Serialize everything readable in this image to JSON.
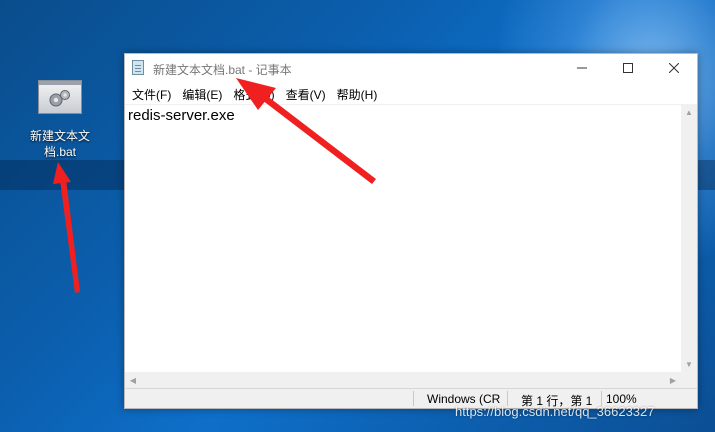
{
  "desktop": {
    "icon_label_line1": "新建文本文",
    "icon_label_line2": "档.bat",
    "icon": "bat-file-gear-icon"
  },
  "window": {
    "title": "新建文本文档.bat - 记事本",
    "controls": {
      "minimize": "minimize-icon",
      "maximize": "maximize-icon",
      "close": "close-icon"
    },
    "menu": [
      {
        "label": "文件(F)"
      },
      {
        "label": "编辑(E)"
      },
      {
        "label": "格式(O)"
      },
      {
        "label": "查看(V)"
      },
      {
        "label": "帮助(H)"
      }
    ],
    "content": "redis-server.exe",
    "status": {
      "encoding": "Windows (CR",
      "position": "第 1 行，第 1",
      "zoom": "100%"
    }
  },
  "watermark": "https://blog.csdn.net/qq_36623327",
  "colors": {
    "annotation_arrow": "#f02020",
    "desktop_bg": "#0b5fae"
  }
}
